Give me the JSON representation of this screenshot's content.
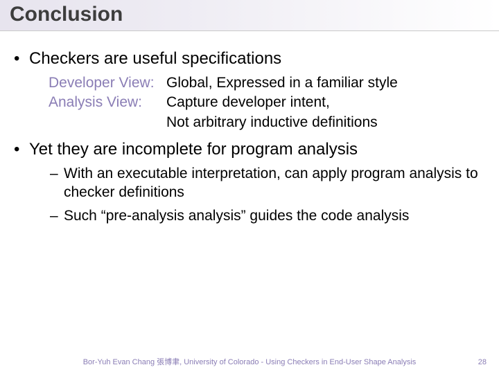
{
  "title": "Conclusion",
  "bullets": {
    "b1": {
      "text": "Checkers are useful specifications",
      "views": {
        "dev_label": "Developer View:",
        "dev_desc": "Global, Expressed in a familiar style",
        "ana_label": "Analysis View:",
        "ana_desc_l1": "Capture developer intent,",
        "ana_desc_l2": "Not arbitrary inductive definitions"
      }
    },
    "b2": {
      "text": "Yet they are incomplete for program analysis",
      "sub": {
        "s1": "With an executable interpretation, can apply program analysis to checker definitions",
        "s2": "Such “pre-analysis analysis” guides the code analysis"
      }
    }
  },
  "footer": {
    "text": "Bor-Yuh Evan Chang 張博聿, University of Colorado - Using Checkers in End-User Shape Analysis",
    "page": "28"
  }
}
